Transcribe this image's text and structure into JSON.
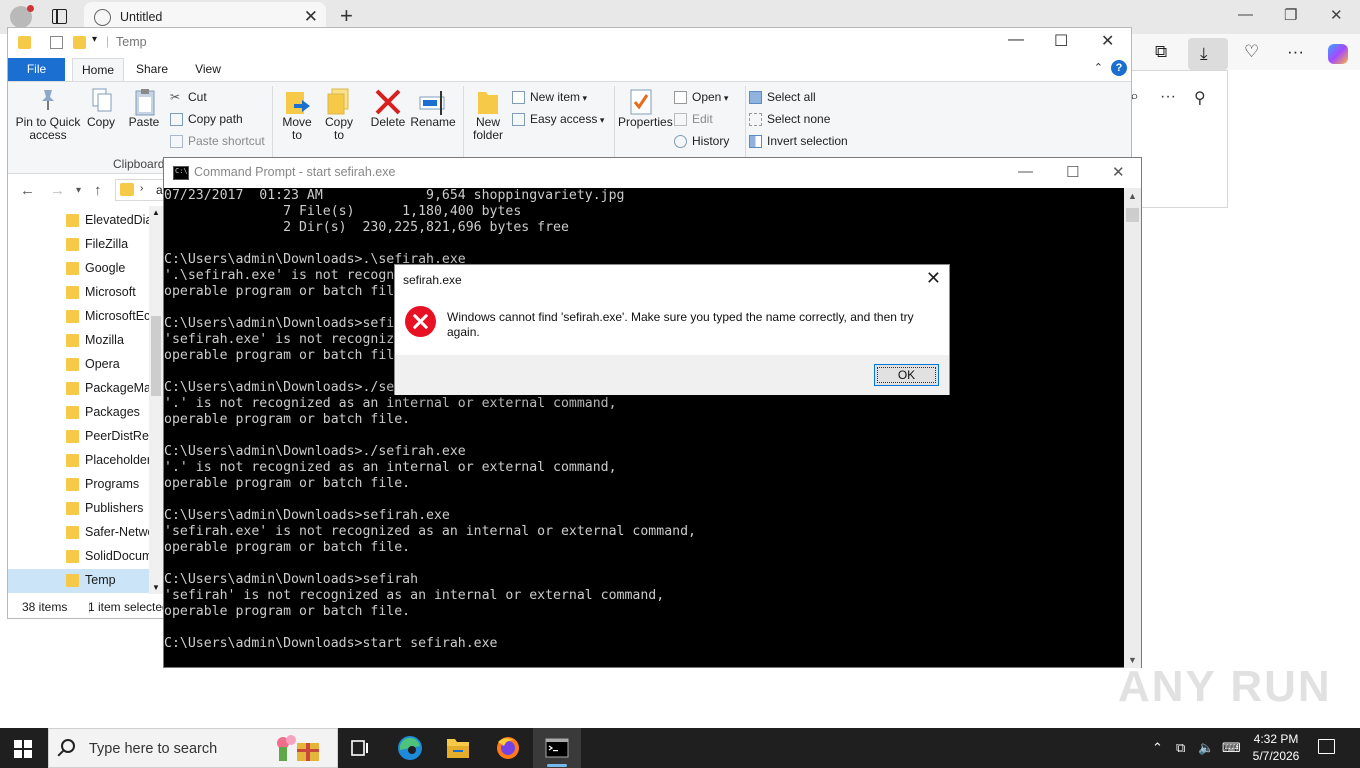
{
  "browser": {
    "tab_title": "Untitled",
    "new_tab_symbol": "+",
    "close_symbol": "✕"
  },
  "explorer": {
    "title": "Temp",
    "tabs": [
      "File",
      "Home",
      "Share",
      "View"
    ],
    "ribbon": {
      "pin_to_quick_access": "Pin to Quick access",
      "copy": "Copy",
      "paste": "Paste",
      "cut": "Cut",
      "copy_path": "Copy path",
      "paste_shortcut": "Paste shortcut",
      "clipboard_group": "Clipboard",
      "move_to": "Move to",
      "copy_to": "Copy to",
      "delete": "Delete",
      "rename": "Rename",
      "new_folder": "New folder",
      "new_item": "New item",
      "easy_access": "Easy access",
      "properties": "Properties",
      "open": "Open",
      "edit": "Edit",
      "history": "History",
      "select_all": "Select all",
      "select_none": "Select none",
      "invert_selection": "Invert selection"
    },
    "address_fragment": "ac",
    "tree_items": [
      "ElevatedDia",
      "FileZilla",
      "Google",
      "Microsoft",
      "MicrosoftEc",
      "Mozilla",
      "Opera",
      "PackageMa",
      "Packages",
      "PeerDistRep",
      "Placeholder",
      "Programs",
      "Publishers",
      "Safer-Netwo",
      "SolidDocum",
      "Temp"
    ],
    "selected_item": "Temp",
    "status_items": "38 items",
    "status_selected": "1 item selected"
  },
  "cmd": {
    "title": "Command Prompt - start  sefirah.exe",
    "lines": [
      "07/23/2017  01:23 AM             9,654 shoppingvariety.jpg",
      "               7 File(s)      1,180,400 bytes",
      "               2 Dir(s)  230,225,821,696 bytes free",
      "",
      "C:\\Users\\admin\\Downloads>.\\sefirah.exe",
      "'.\\sefirah.exe' is not recognized as an internal or external command,",
      "operable program or batch file.",
      "",
      "C:\\Users\\admin\\Downloads>sefirah.exe",
      "'sefirah.exe' is not recognized as an internal or external command,",
      "operable program or batch file.",
      "",
      "C:\\Users\\admin\\Downloads>./sefirah.exe",
      "'.' is not recognized as an internal or external command,",
      "operable program or batch file.",
      "",
      "C:\\Users\\admin\\Downloads>./sefirah.exe",
      "'.' is not recognized as an internal or external command,",
      "operable program or batch file.",
      "",
      "C:\\Users\\admin\\Downloads>sefirah.exe",
      "'sefirah.exe' is not recognized as an internal or external command,",
      "operable program or batch file.",
      "",
      "C:\\Users\\admin\\Downloads>sefirah",
      "'sefirah' is not recognized as an internal or external command,",
      "operable program or batch file.",
      "",
      "C:\\Users\\admin\\Downloads>start sefirah.exe"
    ]
  },
  "dialog": {
    "title": "sefirah.exe",
    "message": "Windows cannot find 'sefirah.exe'. Make sure you typed the name correctly, and then try again.",
    "ok_label": "OK"
  },
  "watermark": "ANY RUN",
  "taskbar": {
    "search_placeholder": "Type here to search",
    "time": "4:32 PM",
    "date": "5/7/2026",
    "apps": [
      "task-view",
      "edge",
      "file-explorer",
      "firefox",
      "command-prompt"
    ]
  },
  "colors": {
    "accent": "#1a6fd1",
    "error": "#e81123",
    "cmd_bg": "#000000",
    "cmd_fg": "#cccccc",
    "folder": "#f7c948"
  }
}
